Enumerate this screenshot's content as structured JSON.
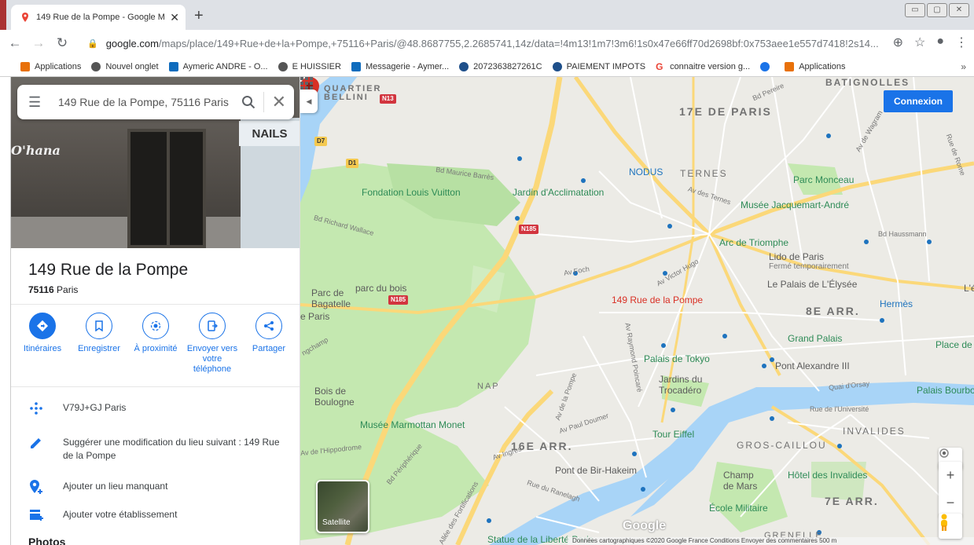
{
  "browser": {
    "tab_title": "149 Rue de la Pompe - Google M",
    "tab_close": "✕",
    "new_tab": "+",
    "window_controls": [
      "▭",
      "▢",
      "✕"
    ],
    "url_host": "google.com",
    "url_path": "/maps/place/149+Rue+de+la+Pompe,+75116+Paris/@48.8687755,2.2685741,14z/data=!4m13!1m7!3m6!1s0x47e66ff70d2698bf:0x753aee1e557d7418!2s14...",
    "bookmarks": [
      {
        "label": "Applications",
        "icon": "apps-grid-icon",
        "color": "#e8710a"
      },
      {
        "label": "Nouvel onglet",
        "icon": "globe-icon",
        "color": "#555555"
      },
      {
        "label": "Aymeric ANDRE - O...",
        "icon": "outlook-icon",
        "color": "#0f6cbd"
      },
      {
        "label": "E HUISSIER",
        "icon": "globe-icon",
        "color": "#555555"
      },
      {
        "label": "Messagerie - Aymer...",
        "icon": "outlook-icon",
        "color": "#0f6cbd"
      },
      {
        "label": "2072363827261C",
        "icon": "circle-icon",
        "color": "#1e4f8a"
      },
      {
        "label": "PAIEMENT IMPOTS",
        "icon": "circle-icon",
        "color": "#1e4f8a"
      },
      {
        "label": "connaitre version g...",
        "icon": "google-g-icon",
        "color": "#ea4335"
      },
      {
        "label": "",
        "icon": "gear-icon",
        "color": "#1a73e8"
      },
      {
        "label": "Applications",
        "icon": "apps-grid-icon",
        "color": "#e8710a"
      }
    ],
    "bookmarks_more": "»"
  },
  "sidebar": {
    "search_value": "149 Rue de la Pompe, 75116 Paris",
    "place_name": "149 Rue de la Pompe",
    "postcode": "75116",
    "city": " Paris",
    "photo_sign_nails": "NAILS",
    "photo_sign_ohana": "O'hana",
    "actions": [
      {
        "label": "Itinéraires",
        "icon": "directions-icon"
      },
      {
        "label": "Enregistrer",
        "icon": "bookmark-icon"
      },
      {
        "label": "À proximité",
        "icon": "nearby-icon"
      },
      {
        "label": "Envoyer vers votre téléphone",
        "icon": "send-to-phone-icon"
      },
      {
        "label": "Partager",
        "icon": "share-icon"
      }
    ],
    "rows": [
      {
        "text": "V79J+GJ Paris",
        "icon": "plus-code-icon"
      },
      {
        "text": "Suggérer une modification du lieu suivant : 149 Rue de la Pompe",
        "icon": "pencil-icon"
      },
      {
        "text": "Ajouter un lieu manquant",
        "icon": "add-place-icon"
      },
      {
        "text": "Ajouter votre établissement",
        "icon": "add-business-icon"
      }
    ],
    "photos_heading": "Photos"
  },
  "map": {
    "connexion_label": "Connexion",
    "satellite_label": "Satellite",
    "google_logo": "Google",
    "attribution": "Données cartographiques ©2020 Google   France   Conditions   Envoyer des commentaires   500 m",
    "selected_place": "149 Rue de la Pompe",
    "districts": [
      "17E DE PARIS",
      "8E ARR.",
      "16E ARR.",
      "7E ARR.",
      "BATIGNOLLES",
      "INVALIDES",
      "GROS-CAILLOU",
      "QUARTIER BELLINI",
      "NAP",
      "GRENELLE"
    ],
    "places_green": [
      "Fondation Louis Vuitton",
      "Jardin d'Acclimatation",
      "Parc Monceau",
      "Musée Jacquemart-André",
      "Arc de Triomphe",
      "Palais de Tokyo",
      "Grand Palais",
      "Musée Marmottan Monet",
      "Tour Eiffel",
      "Hôtel des Invalides",
      "École Militaire",
      "Statue de la Liberté Paris",
      "Place de",
      "Palais Bourbo"
    ],
    "places_gray": [
      "Lido de Paris",
      "Fermé temporairement",
      "Le Palais de L'Élysée",
      "Hermès",
      "Parc de Bagatelle",
      "parc du bois",
      "e Paris",
      "Bois de Boulogne",
      "Jardins du Trocadéro",
      "Pont Alexandre III",
      "Pont de Bir-Hakeim",
      "Champ de Mars",
      "NODUS",
      "TERNES",
      "L'é"
    ],
    "roads": [
      "Bd Maurice Barrès",
      "Bd Richard Wallace",
      "Av Foch",
      "Av Victor Hugo",
      "Av Raymond Poincaré",
      "Av des Ternes",
      "Bd Haussmann",
      "Av Paul Doumer",
      "Av Ingres",
      "Av de l'Hippodrome",
      "Rue du Ranelagh",
      "Quai d'Orsay",
      "Rue de l'Université",
      "Bd Pereire",
      "Av de Wagram",
      "Rue de Rome",
      "Bd Périphérique",
      "Av de la Pompe",
      "Allée des Fortifications",
      "ngchamp"
    ],
    "shields": [
      "N13",
      "D7",
      "D1",
      "N185",
      "N185"
    ],
    "colors": {
      "water": "#a8d4f7",
      "park": "#c4e8b0",
      "major_road": "#fbd879",
      "road": "#ffffff",
      "land": "#ecebe6",
      "pin": "#d93025",
      "accent": "#1a73e8"
    }
  }
}
